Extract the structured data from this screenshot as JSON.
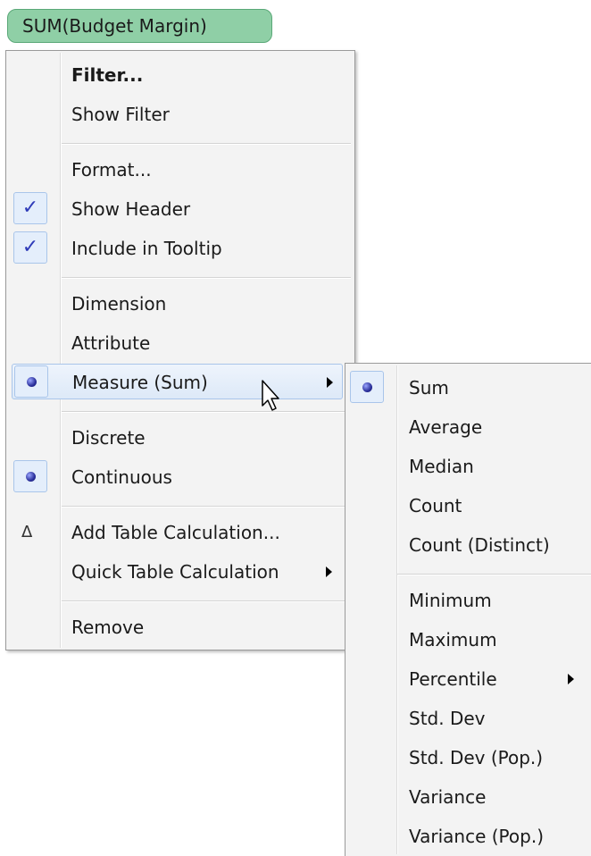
{
  "pill": {
    "label": "SUM(Budget Margin)"
  },
  "main_menu": {
    "filter": "Filter...",
    "show_filter": "Show Filter",
    "format": "Format...",
    "show_header": "Show Header",
    "include_tooltip": "Include in Tooltip",
    "dimension": "Dimension",
    "attribute": "Attribute",
    "measure": "Measure (Sum)",
    "discrete": "Discrete",
    "continuous": "Continuous",
    "add_table_calc": "Add Table Calculation...",
    "quick_table_calc": "Quick Table Calculation",
    "remove": "Remove",
    "check_glyph": "✓",
    "delta_glyph": "Δ"
  },
  "sub_menu": {
    "sum": "Sum",
    "average": "Average",
    "median": "Median",
    "count": "Count",
    "count_distinct": "Count (Distinct)",
    "minimum": "Minimum",
    "maximum": "Maximum",
    "percentile": "Percentile",
    "std_dev": "Std. Dev",
    "std_dev_pop": "Std. Dev (Pop.)",
    "variance": "Variance",
    "variance_pop": "Variance (Pop.)"
  },
  "colors": {
    "pill_bg": "#8fcfa6",
    "menu_bg": "#f3f3f3",
    "highlight_border": "#a9c5ea",
    "check_color": "#2e3ab8"
  },
  "icons": [
    "check-icon",
    "radio-bullet-icon",
    "delta-icon",
    "submenu-arrow-icon",
    "mouse-cursor-icon"
  ]
}
